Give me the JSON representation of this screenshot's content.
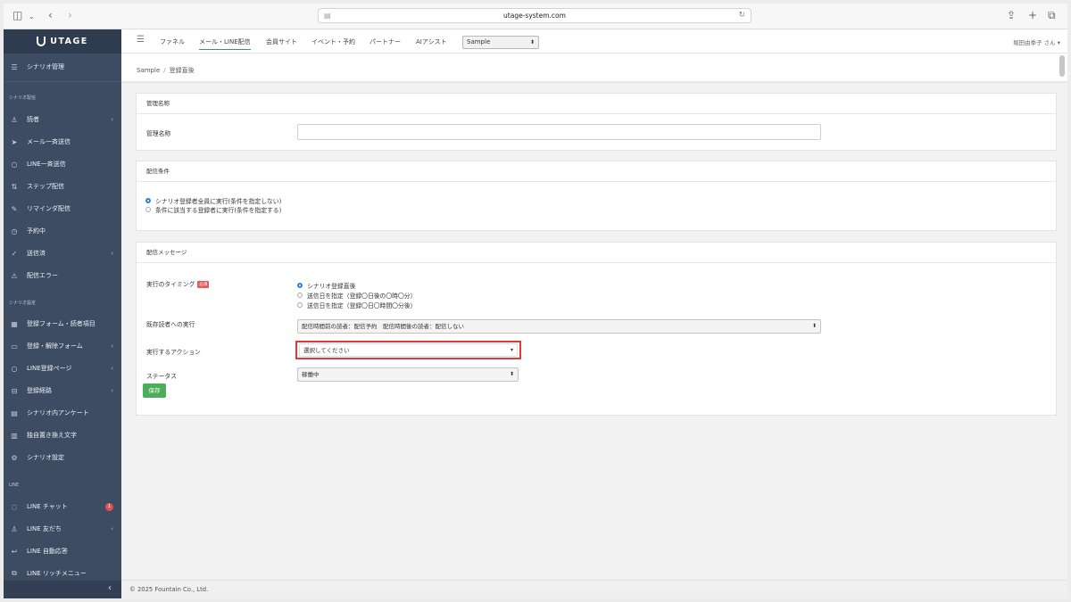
{
  "browser": {
    "url": "utage-system.com",
    "icons": [
      "sidebar-toggle-icon",
      "chevron-down-icon",
      "back-icon",
      "forward-icon",
      "share-icon",
      "plus-icon",
      "tabs-icon"
    ]
  },
  "app": {
    "logo": "UTAGE"
  },
  "sidebar": {
    "top_item": "シナリオ管理",
    "section1": "シナリオ配信",
    "section1_items": [
      "読者",
      "メール一斉送信",
      "LINE一斉送信",
      "ステップ配信",
      "リマインダ配信",
      "予約中",
      "送信済",
      "配信エラー"
    ],
    "section2": "シナリオ設定",
    "section2_items": [
      "登録フォーム・読者項目",
      "登録・解除フォーム",
      "LINE登録ページ",
      "登録経路",
      "シナリオ内アンケート",
      "独自置き換え文字",
      "シナリオ設定"
    ],
    "section3": "LINE",
    "section3_items": [
      "LINE チャット",
      "LINE 友だち",
      "LINE 自動応答",
      "LINE リッチメニュー"
    ],
    "chat_badge": "1"
  },
  "topnav": {
    "tabs": [
      "ファネル",
      "メール・LINE配信",
      "会員サイト",
      "イベント・予約",
      "パートナー",
      "AIアシスト"
    ],
    "select_value": "Sample",
    "user": "堀田由季子 さん"
  },
  "breadcrumb": {
    "root": "Sample",
    "separator": "/",
    "current": "登録直後"
  },
  "card1": {
    "header": "管理名称",
    "label": "管理名称",
    "value": ""
  },
  "card2": {
    "header": "配信条件",
    "option1": "シナリオ登録者全員に実行(条件を指定しない)",
    "option2": "条件に該当する登録者に実行(条件を指定する)"
  },
  "card3": {
    "header": "配信メッセージ",
    "timing_label": "実行のタイミング",
    "required": "必須",
    "timing_options": [
      "シナリオ登録直後",
      "送信日を指定（登録〇日後の〇時〇分）",
      "送信日を指定（登録〇日〇時間〇分後）"
    ],
    "existing_label": "既存読者への実行",
    "existing_value": "配信時間前の読者：配信予約　配信時間後の読者：配信しない",
    "action_label": "実行するアクション",
    "action_value": "選択してください",
    "status_label": "ステータス",
    "status_value": "稼働中",
    "save": "保存"
  },
  "footer": {
    "copyright": "© 2025 Fountain Co., Ltd."
  },
  "colors": {
    "sidebar": "#3d4b63",
    "accent": "#2f80d8",
    "save": "#4aae5a",
    "highlight": "#e23a3a"
  }
}
